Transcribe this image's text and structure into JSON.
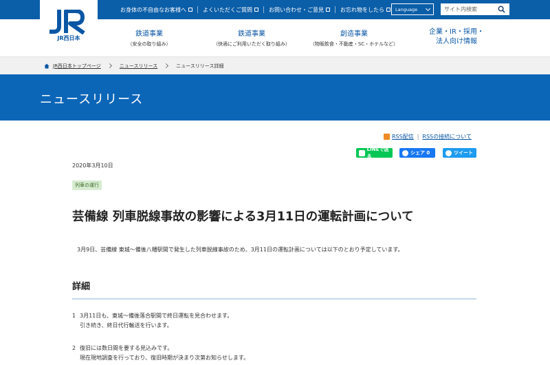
{
  "utility": {
    "links": [
      "お身体の不自由なお客様へ",
      "よくいただくご質問",
      "お問い合わせ・ご意見",
      "お忘れ物をしたら"
    ],
    "language": "Language",
    "search_placeholder": "サイト内検索"
  },
  "logo": {
    "text": "JR西日本"
  },
  "nav": [
    {
      "title": "鉄道事業",
      "sub": "（安全の取り組み）"
    },
    {
      "title": "鉄道事業",
      "sub": "（快適にご利用いただく取り組み）"
    },
    {
      "title": "創造事業",
      "sub": "（物販飲食・不動産・SC・ホテルなど）"
    },
    {
      "title1": "企業・IR・採用・",
      "title2": "法人向け情報"
    }
  ],
  "breadcrumb": [
    "JR西日本トップページ",
    "ニュースリリース",
    "ニュースリリース詳細"
  ],
  "hero": {
    "title": "ニュースリリース"
  },
  "rss": {
    "feed": "RSS配信",
    "about": "RSSの接続について"
  },
  "share": {
    "line": "LINEで送る",
    "facebook": "シェア 0",
    "twitter": "ツイート"
  },
  "article": {
    "date": "2020年3月10日",
    "category": "列車の運行",
    "title": "芸備線 列車脱線事故の影響による3月11日の運転計画について",
    "lead": "3月9日、芸備線 東城～備後八幡駅間で発生した列車脱線事故のため、3月11日の運転計画については以下のとおり予定しています。",
    "section_heading": "詳細",
    "items": [
      {
        "num": "1",
        "line1": "3月11日も、東城～備後落合駅間で終日運転を見合わせます。",
        "line2": "引き続き、終日代行輸送を行います。"
      },
      {
        "num": "2",
        "line1": "復旧には数日間を要する見込みです。",
        "line2": "現在現地調査を行っており、復旧時期が決まり次第お知らせします。"
      }
    ]
  },
  "colors": {
    "brand_blue": "#0b5ea8",
    "hero_blue": "#0b66b8",
    "line_green": "#06c755",
    "facebook_blue": "#1877f2",
    "twitter_blue": "#1d9bf0",
    "rss_orange": "#f08a24"
  }
}
